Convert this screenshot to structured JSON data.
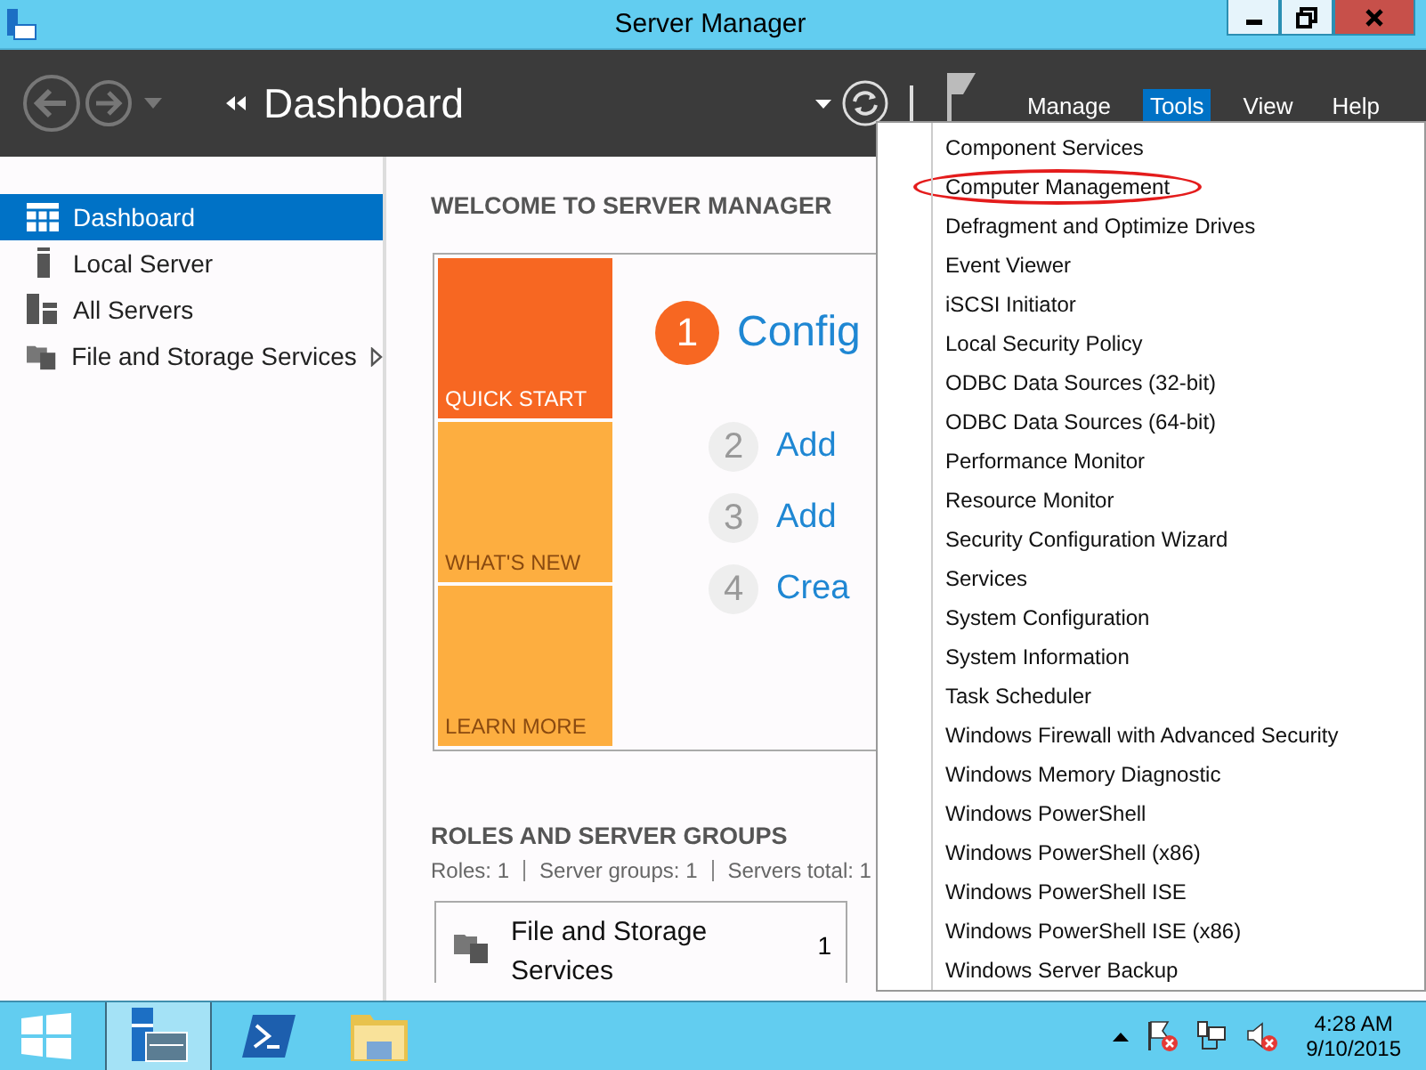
{
  "window": {
    "title": "Server Manager"
  },
  "toolbar": {
    "breadcrumb": "Dashboard",
    "menus": [
      {
        "label": "Manage",
        "selected": false
      },
      {
        "label": "Tools",
        "selected": true
      },
      {
        "label": "View",
        "selected": false
      },
      {
        "label": "Help",
        "selected": false
      }
    ]
  },
  "sidebar": {
    "items": [
      {
        "label": "Dashboard",
        "kind": "dashboard",
        "selected": true,
        "has_submenu": false
      },
      {
        "label": "Local Server",
        "kind": "server",
        "selected": false,
        "has_submenu": false
      },
      {
        "label": "All Servers",
        "kind": "servers",
        "selected": false,
        "has_submenu": false
      },
      {
        "label": "File and Storage Services",
        "kind": "storage",
        "selected": false,
        "has_submenu": true
      }
    ]
  },
  "welcome": {
    "title": "WELCOME TO SERVER MANAGER",
    "tiles": [
      {
        "label": "QUICK START",
        "selected": true
      },
      {
        "label": "WHAT'S NEW",
        "selected": false
      },
      {
        "label": "LEARN MORE",
        "selected": false
      }
    ],
    "steps": [
      {
        "number": "1",
        "label": "Config",
        "current": true
      },
      {
        "number": "2",
        "label": "Add",
        "current": false
      },
      {
        "number": "3",
        "label": "Add",
        "current": false
      },
      {
        "number": "4",
        "label": "Crea",
        "current": false
      }
    ]
  },
  "roles": {
    "title": "ROLES AND SERVER GROUPS",
    "summary": [
      "Roles: 1",
      "Server groups: 1",
      "Servers total: 1"
    ],
    "cards": [
      {
        "name": "File and Storage Services",
        "count": "1"
      }
    ]
  },
  "tools_menu": {
    "items": [
      {
        "label": "Component Services",
        "highlighted": false
      },
      {
        "label": "Computer Management",
        "highlighted": true
      },
      {
        "label": "Defragment and Optimize Drives",
        "highlighted": false
      },
      {
        "label": "Event Viewer",
        "highlighted": false
      },
      {
        "label": "iSCSI Initiator",
        "highlighted": false
      },
      {
        "label": "Local Security Policy",
        "highlighted": false
      },
      {
        "label": "ODBC Data Sources (32-bit)",
        "highlighted": false
      },
      {
        "label": "ODBC Data Sources (64-bit)",
        "highlighted": false
      },
      {
        "label": "Performance Monitor",
        "highlighted": false
      },
      {
        "label": "Resource Monitor",
        "highlighted": false
      },
      {
        "label": "Security Configuration Wizard",
        "highlighted": false
      },
      {
        "label": "Services",
        "highlighted": false
      },
      {
        "label": "System Configuration",
        "highlighted": false
      },
      {
        "label": "System Information",
        "highlighted": false
      },
      {
        "label": "Task Scheduler",
        "highlighted": false
      },
      {
        "label": "Windows Firewall with Advanced Security",
        "highlighted": false
      },
      {
        "label": "Windows Memory Diagnostic",
        "highlighted": false
      },
      {
        "label": "Windows PowerShell",
        "highlighted": false
      },
      {
        "label": "Windows PowerShell (x86)",
        "highlighted": false
      },
      {
        "label": "Windows PowerShell ISE",
        "highlighted": false
      },
      {
        "label": "Windows PowerShell ISE (x86)",
        "highlighted": false
      },
      {
        "label": "Windows Server Backup",
        "highlighted": false
      }
    ]
  },
  "taskbar": {
    "apps": [
      {
        "kind": "server-manager",
        "selected": true
      },
      {
        "kind": "powershell",
        "selected": false
      },
      {
        "kind": "explorer",
        "selected": false
      }
    ],
    "clock": {
      "time": "4:28 AM",
      "date": "9/10/2015"
    }
  }
}
